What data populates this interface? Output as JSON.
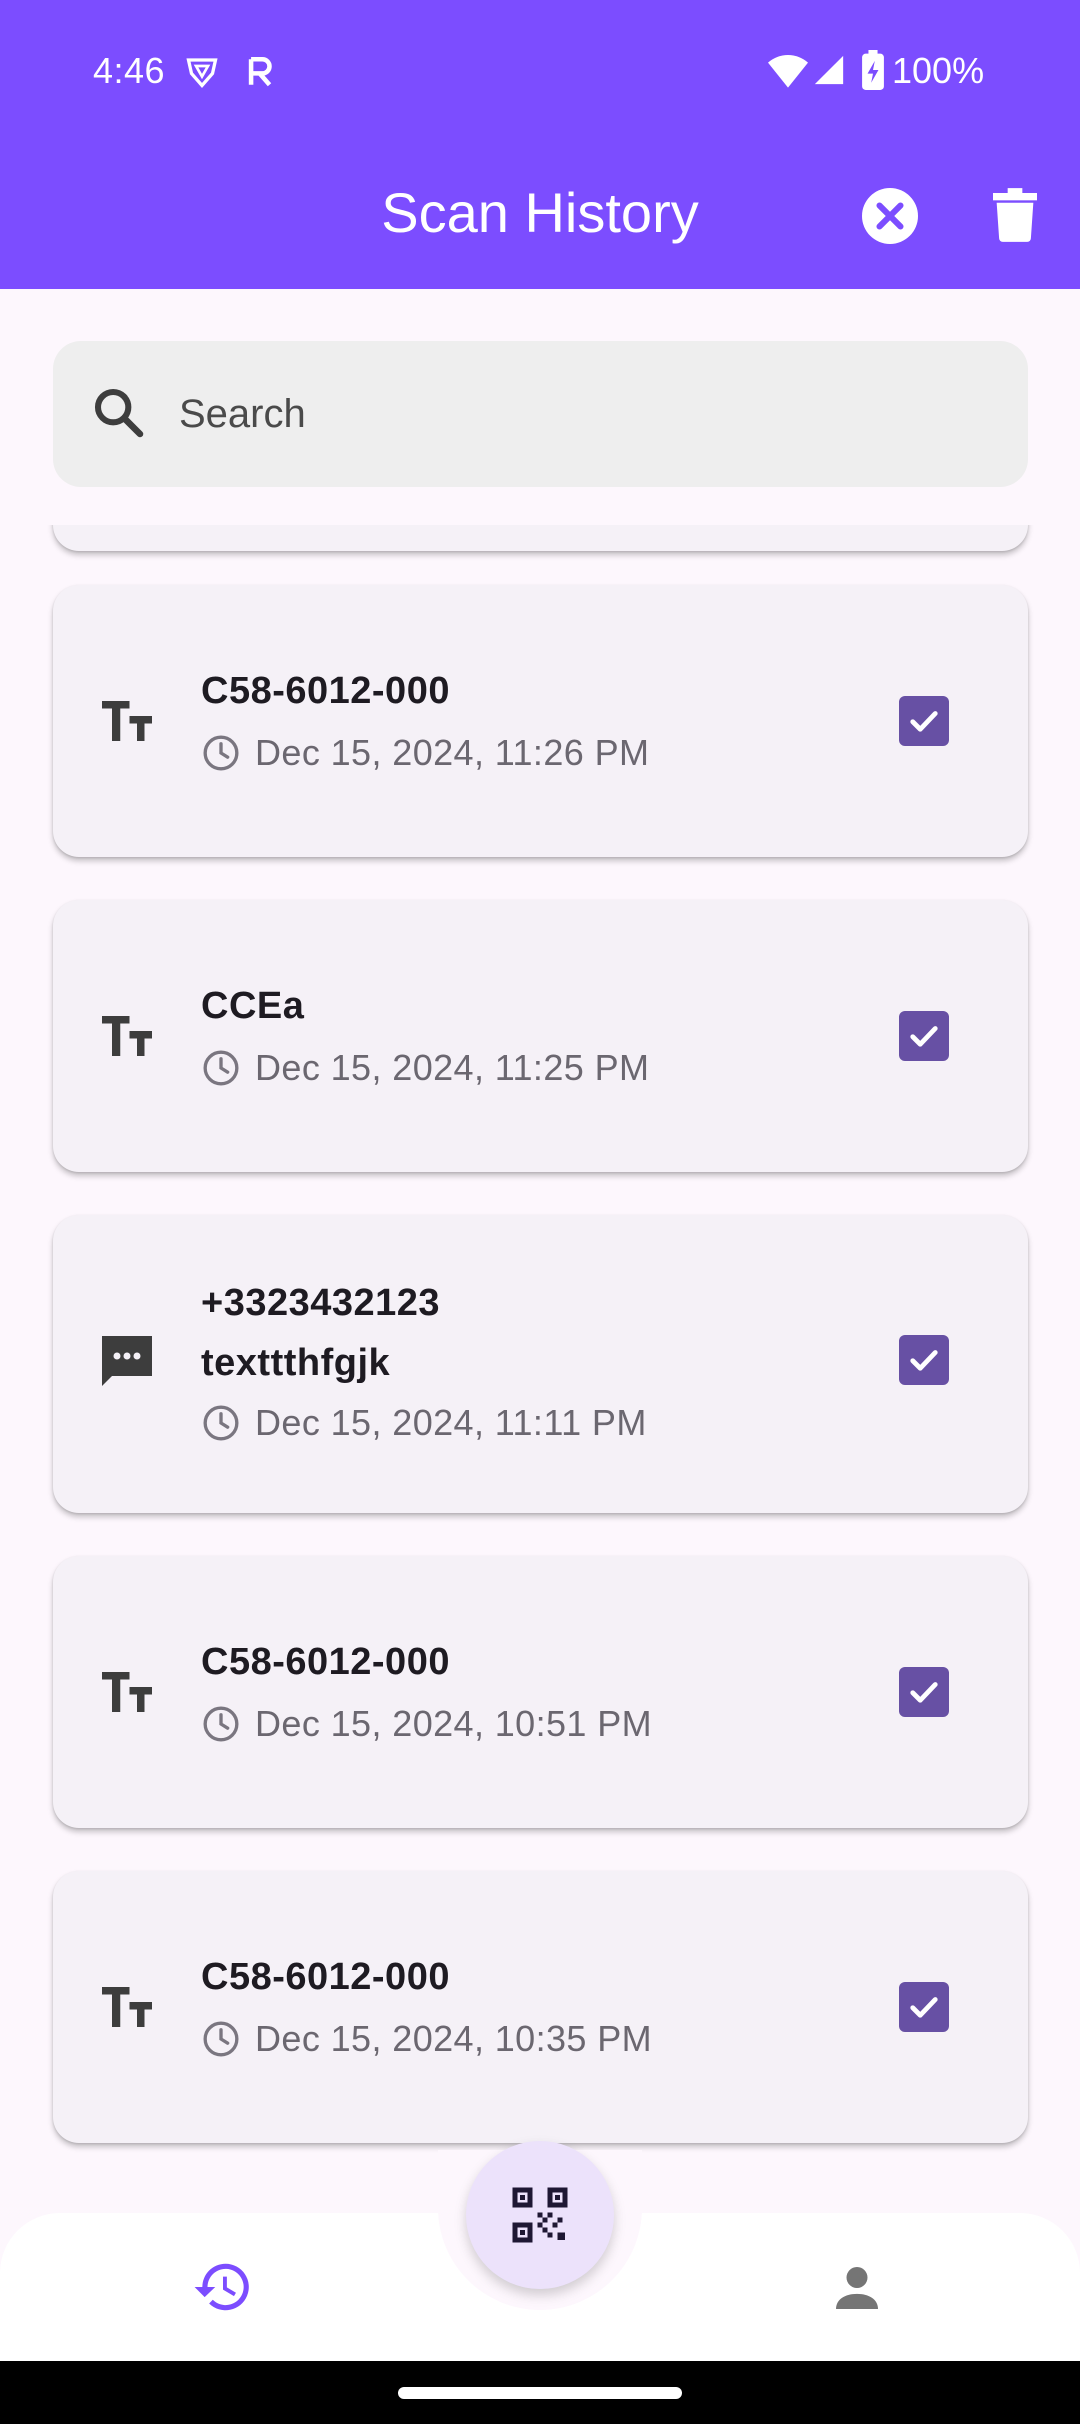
{
  "status_bar": {
    "time": "4:46",
    "battery": "100%"
  },
  "appbar": {
    "title": "Scan History"
  },
  "search": {
    "placeholder": "Search"
  },
  "history": [
    {
      "type": "text",
      "title": "C58-6012-000",
      "time": "Dec 15, 2024, 11:26 PM",
      "checked": true
    },
    {
      "type": "text",
      "title": "CCEa",
      "time": "Dec 15, 2024, 11:25 PM",
      "checked": true
    },
    {
      "type": "sms",
      "title": "+3323432123",
      "subtitle": "texttthfgjk",
      "time": "Dec 15, 2024, 11:11 PM",
      "checked": true
    },
    {
      "type": "text",
      "title": "C58-6012-000",
      "time": "Dec 15, 2024, 10:51 PM",
      "checked": true
    },
    {
      "type": "text",
      "title": "C58-6012-000",
      "time": "Dec 15, 2024, 10:35 PM",
      "checked": true
    }
  ],
  "icons": {
    "appbar_close": "close-circle-icon",
    "appbar_delete": "trash-icon",
    "search": "search-icon",
    "text_item": "text-fields-icon",
    "sms_item": "sms-icon",
    "time": "clock-icon",
    "check": "checkbox-checked-icon",
    "fab": "qr-code-scanner-icon",
    "nav_history": "history-icon",
    "nav_profile": "person-icon"
  },
  "colors": {
    "primary": "#7c4dff",
    "checkbox": "#6750a4",
    "card_bg": "#f5f1f7",
    "fab_bg": "#ece2fb",
    "nav_active": "#7c4dff",
    "nav_inactive": "#757575"
  }
}
